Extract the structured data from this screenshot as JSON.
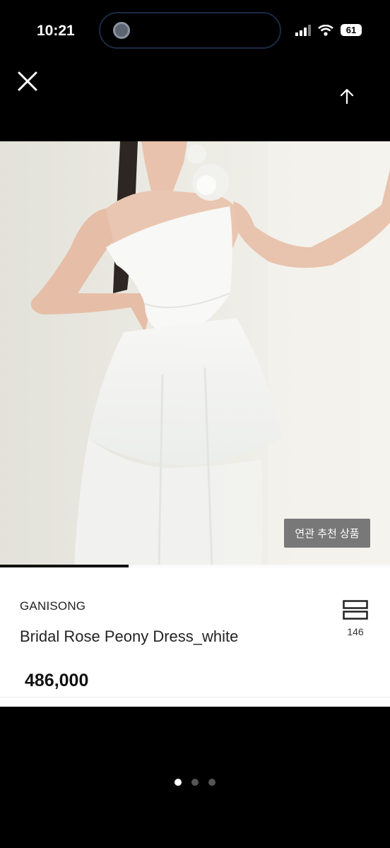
{
  "status_bar": {
    "time": "10:21",
    "battery": "61"
  },
  "product": {
    "related_button_label": "연관 추천 상품",
    "brand": "GANISONG",
    "name": "Bridal Rose Peony Dress_white",
    "price": "486,000",
    "like_count": "146",
    "image_progress": 0.33
  },
  "icons": {
    "close": "close-icon",
    "bookmark": "bookmark-icon",
    "scroll_top": "arrow-up-icon"
  },
  "pager": {
    "pages": 3,
    "active": 0
  },
  "colors": {
    "overlay_button": "#6e6e6e",
    "dot_active": "#ffffff",
    "dot_inactive": "#555555"
  }
}
